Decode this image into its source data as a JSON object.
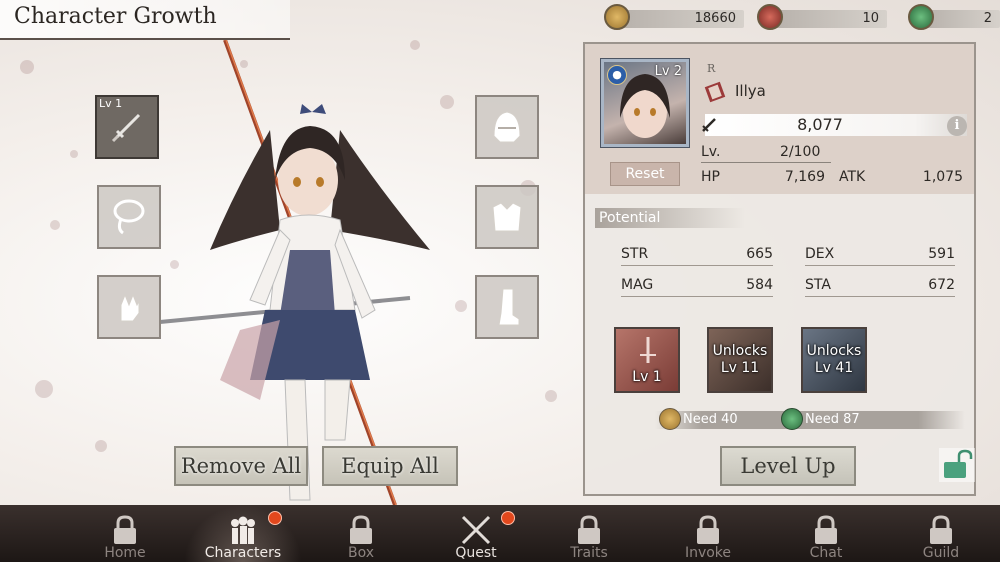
{
  "header": {
    "title": "Character Growth"
  },
  "currencies": [
    {
      "name": "gold-coin",
      "value": "18660",
      "color": "#c79a4f"
    },
    {
      "name": "red-gem",
      "value": "10",
      "color": "#b5423a"
    },
    {
      "name": "green-gem",
      "value": "2",
      "color": "#3f8a55"
    }
  ],
  "equipment": {
    "weapon": {
      "level": "Lv 1",
      "icon": "dagger-icon"
    },
    "necklace": {
      "icon": "necklace-icon"
    },
    "gloves": {
      "icon": "glove-icon"
    },
    "helmet": {
      "icon": "helmet-icon"
    },
    "armor": {
      "icon": "armor-icon"
    },
    "boots": {
      "icon": "boot-icon"
    },
    "remove_all_label": "Remove All",
    "equip_all_label": "Equip All"
  },
  "character": {
    "name": "Illya",
    "rarity": "R",
    "level_tag": "Lv 2",
    "power": "8,077",
    "lv_label": "Lv.",
    "lv_value": "2/100",
    "hp_label": "HP",
    "hp_value": "7,169",
    "atk_label": "ATK",
    "atk_value": "1,075",
    "reset_label": "Reset"
  },
  "potential": {
    "header": "Potential",
    "stats": [
      {
        "label": "STR",
        "value": "665"
      },
      {
        "label": "DEX",
        "value": "591"
      },
      {
        "label": "MAG",
        "value": "584"
      },
      {
        "label": "STA",
        "value": "672"
      }
    ]
  },
  "skills": [
    {
      "line1": "",
      "line2": "Lv 1",
      "color": "#8c5048"
    },
    {
      "line1": "Unlocks",
      "line2": "Lv 11",
      "color": "#5e4a40"
    },
    {
      "line1": "Unlocks",
      "line2": "Lv 41",
      "color": "#45505c"
    }
  ],
  "requirements": {
    "gold": "Need 40",
    "gem": "Need 87"
  },
  "level_up_label": "Level Up",
  "nav": [
    {
      "label": "Home",
      "icon": "lock-icon",
      "active": false
    },
    {
      "label": "Characters",
      "icon": "characters-icon",
      "active": true,
      "badge": true
    },
    {
      "label": "Box",
      "icon": "lock-icon",
      "active": false
    },
    {
      "label": "Quest",
      "icon": "crossed-swords-icon",
      "active": false,
      "badge": true
    },
    {
      "label": "Traits",
      "icon": "lock-icon",
      "active": false
    },
    {
      "label": "Invoke",
      "icon": "lock-icon",
      "active": false
    },
    {
      "label": "Chat",
      "icon": "lock-icon",
      "active": false
    },
    {
      "label": "Guild",
      "icon": "lock-icon",
      "active": false
    }
  ]
}
